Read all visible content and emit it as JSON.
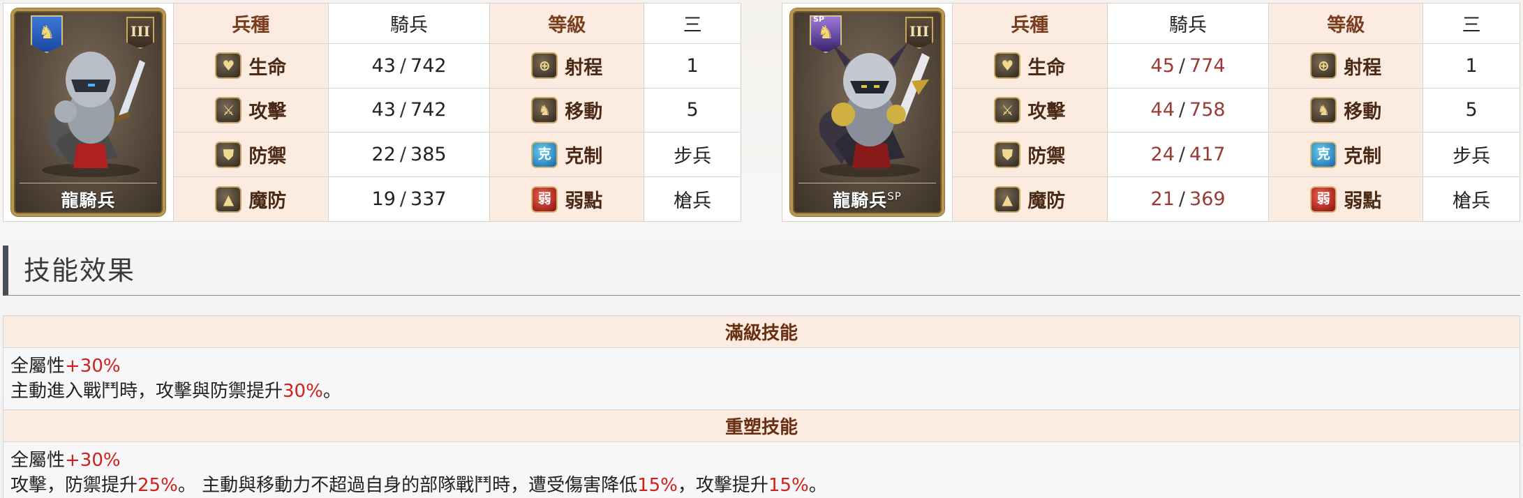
{
  "units": [
    {
      "name": "龍騎兵",
      "sp": "",
      "badge_icon": "horse-head-icon",
      "rank_numeral": "III",
      "type_header": "兵種",
      "type_value": "騎兵",
      "level_header": "等級",
      "level_value": "三",
      "stats_left": [
        {
          "label": "生命",
          "icon": "heart-icon",
          "base": "43",
          "max": "742"
        },
        {
          "label": "攻擊",
          "icon": "sword-icon",
          "base": "43",
          "max": "742"
        },
        {
          "label": "防禦",
          "icon": "shield-icon",
          "base": "22",
          "max": "385"
        },
        {
          "label": "魔防",
          "icon": "magic-defense-icon",
          "base": "19",
          "max": "337"
        }
      ],
      "stats_right": [
        {
          "label": "射程",
          "icon": "crosshair-icon",
          "value": "1"
        },
        {
          "label": "移動",
          "icon": "horse-move-icon",
          "value": "5"
        },
        {
          "label": "克制",
          "icon": "counter-icon",
          "glyph": "克",
          "value": "步兵"
        },
        {
          "label": "弱點",
          "icon": "weakness-icon",
          "glyph": "弱",
          "value": "槍兵"
        }
      ]
    },
    {
      "name": "龍騎兵",
      "sp": "SP",
      "badge_icon": "dark-horse-sp-icon",
      "rank_numeral": "III",
      "type_header": "兵種",
      "type_value": "騎兵",
      "level_header": "等級",
      "level_value": "三",
      "stats_left": [
        {
          "label": "生命",
          "icon": "heart-icon",
          "base": "45",
          "max": "774"
        },
        {
          "label": "攻擊",
          "icon": "sword-icon",
          "base": "44",
          "max": "758"
        },
        {
          "label": "防禦",
          "icon": "shield-icon",
          "base": "24",
          "max": "417"
        },
        {
          "label": "魔防",
          "icon": "magic-defense-icon",
          "base": "21",
          "max": "369"
        }
      ],
      "stats_right": [
        {
          "label": "射程",
          "icon": "crosshair-icon",
          "value": "1"
        },
        {
          "label": "移動",
          "icon": "horse-move-icon",
          "value": "5"
        },
        {
          "label": "克制",
          "icon": "counter-icon",
          "glyph": "克",
          "value": "步兵"
        },
        {
          "label": "弱點",
          "icon": "weakness-icon",
          "glyph": "弱",
          "value": "槍兵"
        }
      ]
    }
  ],
  "section": {
    "title": "技能效果"
  },
  "skills": [
    {
      "header": "滿級技能",
      "lines": [
        [
          {
            "t": "全屬性"
          },
          {
            "t": "+30%",
            "hl": true
          }
        ],
        [
          {
            "t": "主動進入戰鬥時，攻擊與防禦提升"
          },
          {
            "t": "30%",
            "hl": true
          },
          {
            "t": "。"
          }
        ]
      ]
    },
    {
      "header": "重塑技能",
      "lines": [
        [
          {
            "t": "全屬性"
          },
          {
            "t": "+30%",
            "hl": true
          }
        ],
        [
          {
            "t": "攻擊，防禦提升"
          },
          {
            "t": "25%",
            "hl": true
          },
          {
            "t": "。 主動與移動力不超過自身的部隊戰鬥時，遭受傷害降低"
          },
          {
            "t": "15%",
            "hl": true
          },
          {
            "t": "，攻擊提升"
          },
          {
            "t": "15%",
            "hl": true
          },
          {
            "t": "。"
          }
        ]
      ]
    }
  ],
  "colors": {
    "highlight": "#d0201a",
    "header_bg": "#fcebe0",
    "sp_stat": "#9b3a33"
  }
}
